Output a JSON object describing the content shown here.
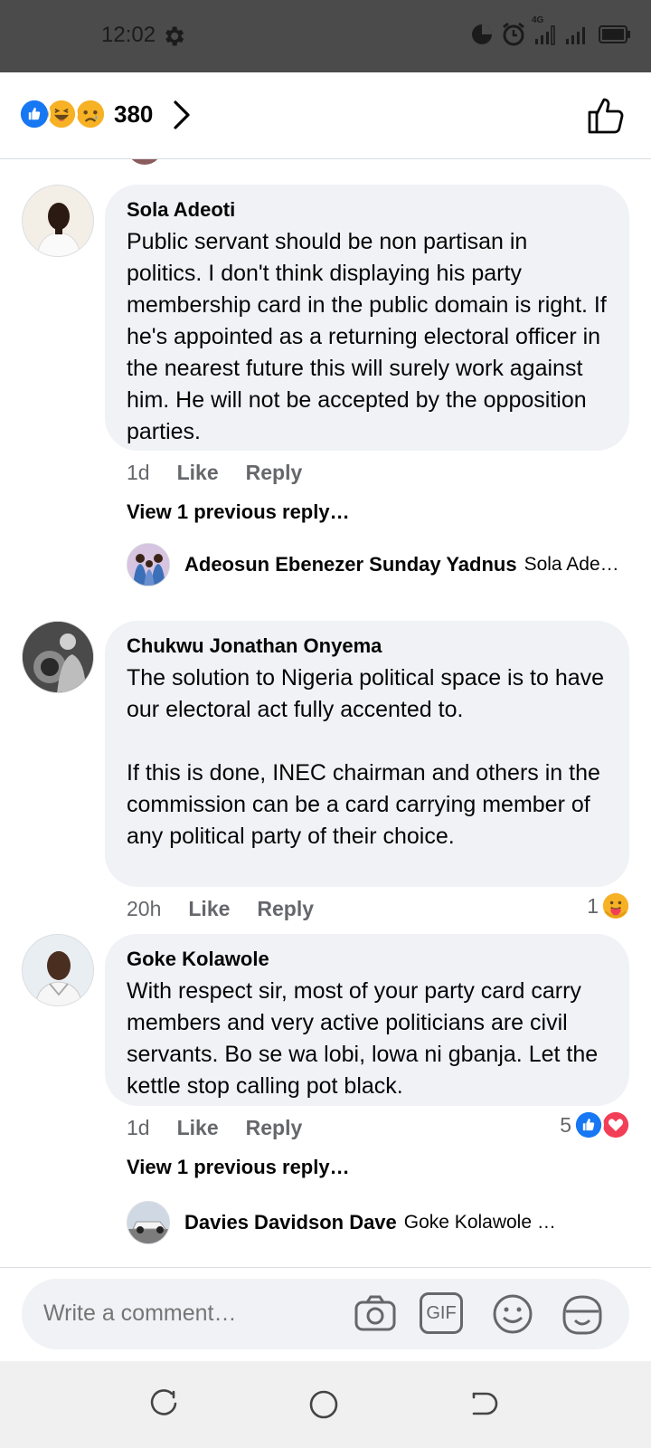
{
  "status": {
    "time": "12:02",
    "network": "4G"
  },
  "reactions": {
    "count": "380",
    "icons": [
      "like-reaction-icon",
      "haha-reaction-icon",
      "sad-reaction-icon"
    ]
  },
  "comments": [
    {
      "author": "Sola Adeoti",
      "text": "Public servant should be non partisan in politics. I don't think displaying his party membership card in the public domain is right. If he's appointed as a returning electoral officer in the nearest future this will surely work against him. He will not be accepted by the opposition parties.",
      "time": "1d",
      "like": "Like",
      "reply": "Reply",
      "view_previous": "View 1 previous reply…",
      "reply_preview": {
        "author": "Adeosun Ebenezer Sunday Yadnus",
        "snippet": "Sola Ade…"
      }
    },
    {
      "author": "Chukwu Jonathan Onyema",
      "text": "The solution to Nigeria political space is to have our electoral act fully accented to.\n\nIf this is done, INEC chairman and others in the commission can be a card carrying member of any political party of their choice.",
      "time": "20h",
      "like": "Like",
      "reply": "Reply",
      "reaction_count": "1"
    },
    {
      "author": "Goke Kolawole",
      "text": "With respect sir, most of your party card carry members and very active politicians are civil servants. Bo se wa lobi, lowa ni gbanja. Let the kettle stop calling pot black.",
      "time": "1d",
      "like": "Like",
      "reply": "Reply",
      "reaction_count": "5",
      "view_previous": "View 1 previous reply…",
      "reply_preview": {
        "author": "Davies Davidson Dave",
        "snippet": "Goke Kolawole …"
      }
    }
  ],
  "composer": {
    "placeholder": "Write a comment…",
    "gif_label": "GIF"
  },
  "colors": {
    "bubble": "#f0f2f5",
    "meta_text": "#65676b",
    "like_blue": "#1877f2",
    "love_red": "#f33e58",
    "status_bar": "#4b4b4b"
  }
}
